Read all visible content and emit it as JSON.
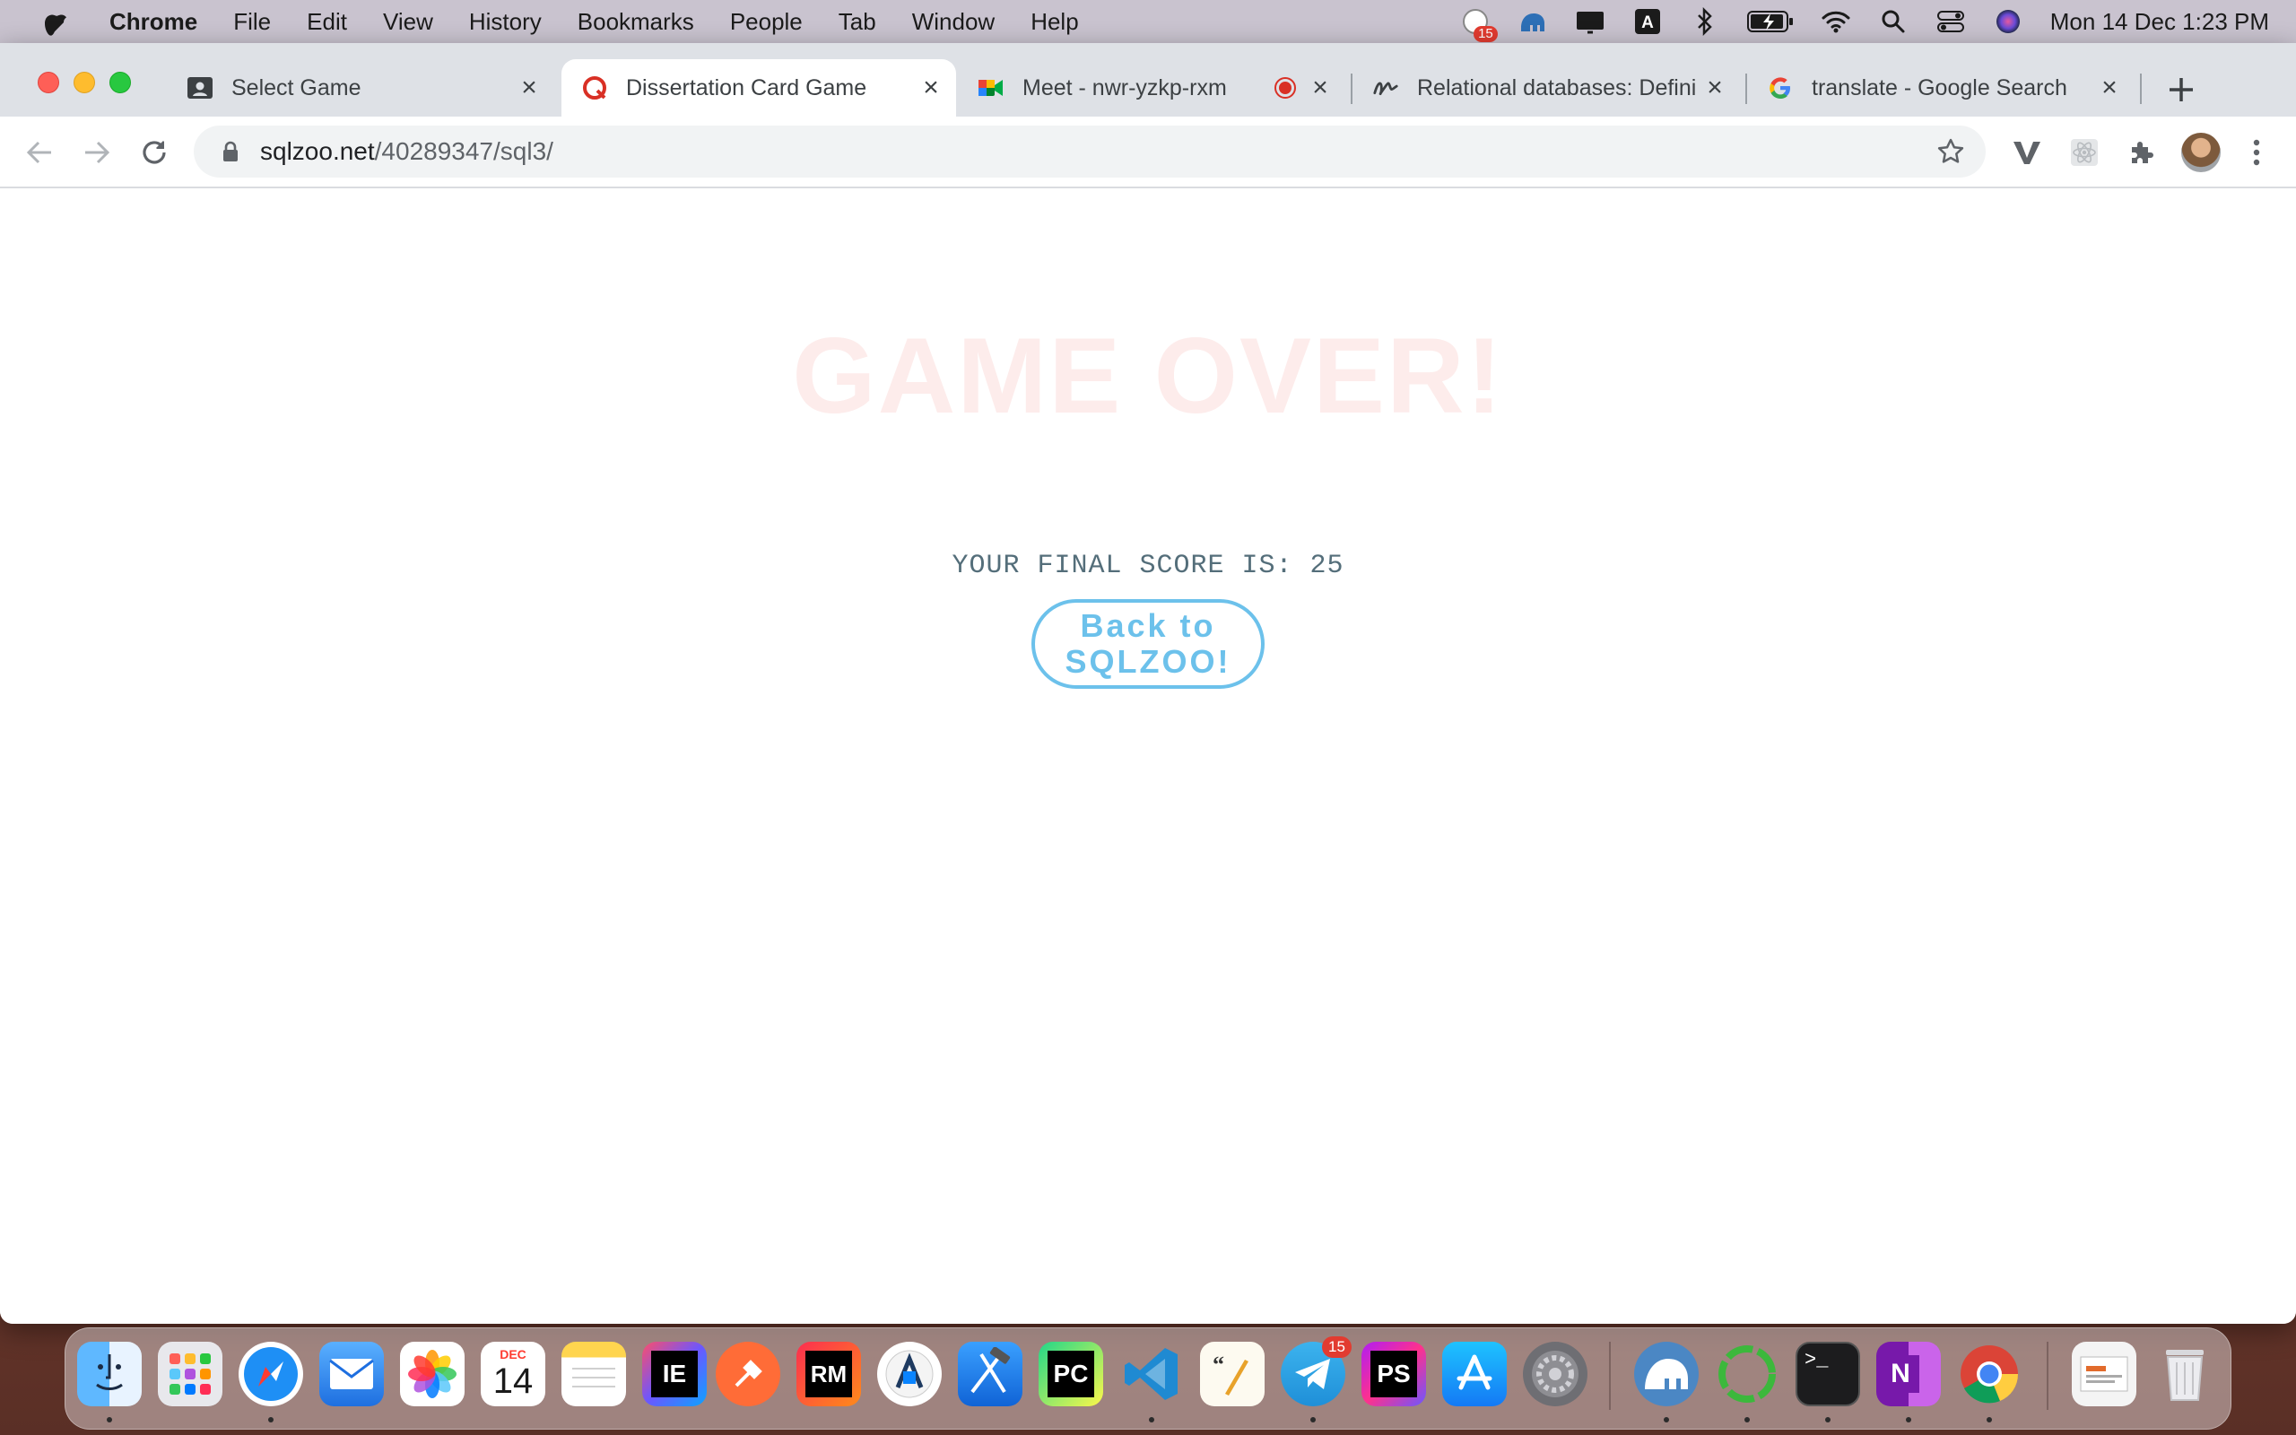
{
  "menubar": {
    "app_name": "Chrome",
    "menus": [
      "File",
      "Edit",
      "View",
      "History",
      "Bookmarks",
      "People",
      "Tab",
      "Window",
      "Help"
    ],
    "notification_badge": "15",
    "clock": "Mon 14 Dec  1:23 PM"
  },
  "tabs": [
    {
      "title": "Select Game",
      "active": false
    },
    {
      "title": "Dissertation Card Game",
      "active": true
    },
    {
      "title": "Meet - nwr-yzkp-rxm",
      "active": false
    },
    {
      "title": "Relational databases: Defini",
      "active": false
    },
    {
      "title": "translate - Google Search",
      "active": false
    }
  ],
  "omnibox": {
    "domain": "sqlzoo.net",
    "path": "/40289347/sql3/"
  },
  "page": {
    "heading": "GAME OVER!",
    "final_score_label": "YOUR FINAL SCORE IS:",
    "final_score_value": "25",
    "back_button_label": "Back to SQLZOO!"
  },
  "dock": {
    "calendar_month": "DEC",
    "calendar_day": "14",
    "telegram_badge": "15",
    "apps": [
      "Finder",
      "Launchpad",
      "Safari",
      "Mail",
      "Photos",
      "Calendar",
      "Notes",
      "IntelliJ IDEA",
      "Postman",
      "RubyMine",
      "Instruments",
      "Xcode",
      "PyCharm",
      "Visual Studio Code",
      "Script Editor",
      "Telegram",
      "PhpStorm",
      "App Store",
      "System Preferences",
      "Sequel Ace",
      "Cursor",
      "Terminal",
      "OneNote",
      "Chrome",
      "Downloads",
      "Trash"
    ]
  },
  "colors": {
    "game_over": "#fdeceb",
    "score_text": "#546e7a",
    "button_accent": "#6cc1eb"
  }
}
